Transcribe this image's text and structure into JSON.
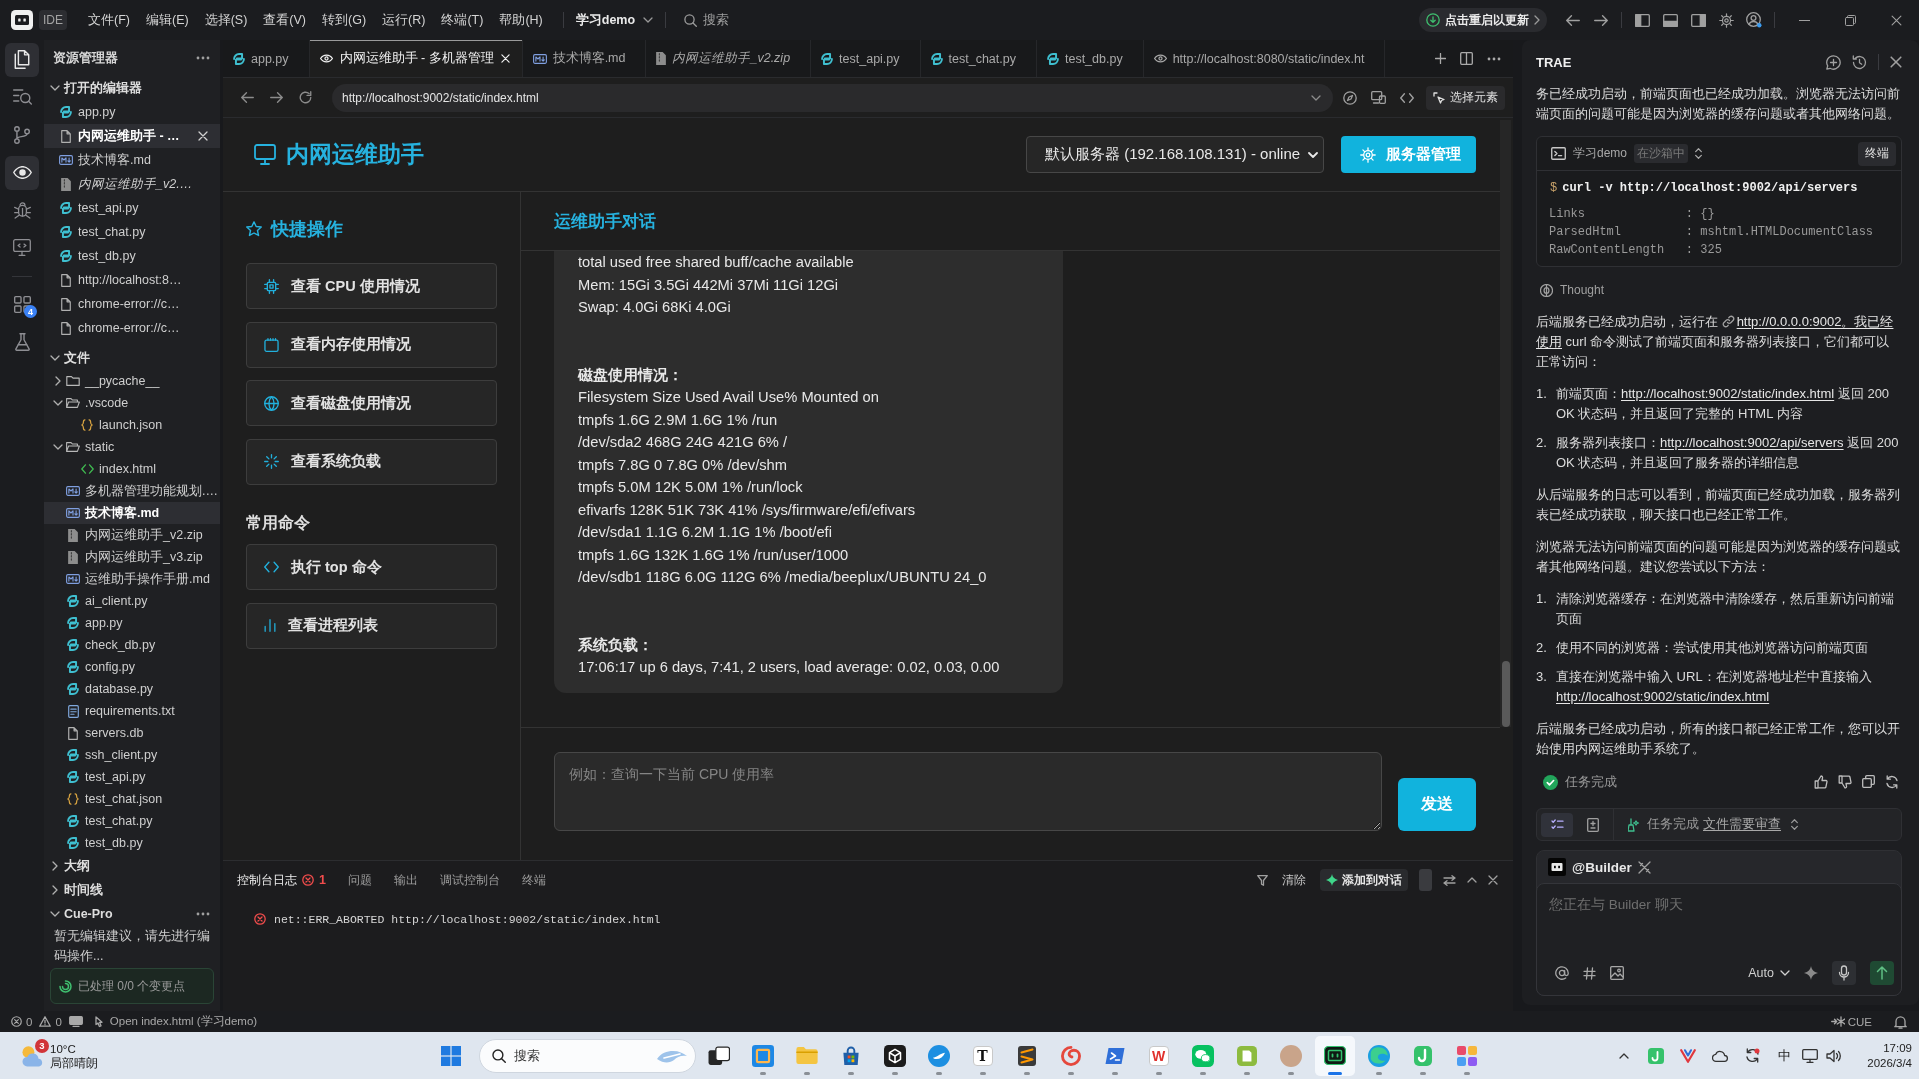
{
  "title_bar": {
    "app_name": "IDE",
    "menus": [
      "文件(F)",
      "编辑(E)",
      "选择(S)",
      "查看(V)",
      "转到(G)",
      "运行(R)",
      "终端(T)",
      "帮助(H)"
    ],
    "project": "学习demo",
    "search_placeholder": "搜索",
    "update_button": "点击重启以更新"
  },
  "activity_bar": {
    "items": [
      {
        "kind": "files",
        "selected": true
      },
      {
        "kind": "search",
        "selected": false
      },
      {
        "kind": "source-control",
        "selected": false
      },
      {
        "kind": "preview",
        "selected": true
      },
      {
        "kind": "debug",
        "selected": false
      },
      {
        "kind": "remote",
        "selected": false
      },
      {
        "kind": "extensions",
        "selected": false,
        "badge": "4"
      },
      {
        "kind": "testing",
        "selected": false
      }
    ]
  },
  "explorer": {
    "title": "资源管理器",
    "open_editors": {
      "title": "打开的编辑器",
      "expanded": true,
      "items": [
        {
          "name": "app.py",
          "kind": "python",
          "selected": false,
          "preview": false
        },
        {
          "name": "内网运维助手 - …",
          "kind": "file",
          "selected": true,
          "preview": false
        },
        {
          "name": "技术博客.md",
          "kind": "markdown",
          "selected": false,
          "preview": false
        },
        {
          "name": "内网运维助手_v2.…",
          "kind": "zip",
          "selected": false,
          "preview": true
        },
        {
          "name": "test_api.py",
          "kind": "python",
          "selected": false,
          "preview": false
        },
        {
          "name": "test_chat.py",
          "kind": "python",
          "selected": false,
          "preview": false
        },
        {
          "name": "test_db.py",
          "kind": "python",
          "selected": false,
          "preview": false
        },
        {
          "name": "http://localhost:8…",
          "kind": "file",
          "selected": false,
          "preview": false
        },
        {
          "name": "chrome-error://c…",
          "kind": "file",
          "selected": false,
          "preview": false
        },
        {
          "name": "chrome-error://c…",
          "kind": "file",
          "selected": false,
          "preview": false
        }
      ]
    },
    "files": {
      "title": "文件",
      "expanded": true,
      "tree": [
        {
          "name": "__pycache__",
          "kind": "folder",
          "expanded": false,
          "selected": false
        },
        {
          "name": ".vscode",
          "kind": "folder",
          "expanded": true,
          "selected": false,
          "children": [
            {
              "name": "launch.json",
              "kind": "json",
              "selected": false
            }
          ]
        },
        {
          "name": "static",
          "kind": "folder",
          "expanded": true,
          "selected": false,
          "children": [
            {
              "name": "index.html",
              "kind": "html",
              "selected": false
            }
          ]
        },
        {
          "name": "多机器管理功能规划.…",
          "kind": "markdown",
          "selected": false
        },
        {
          "name": "技术博客.md",
          "kind": "markdown",
          "selected": true
        },
        {
          "name": "内网运维助手_v2.zip",
          "kind": "zip",
          "selected": false
        },
        {
          "name": "内网运维助手_v3.zip",
          "kind": "zip",
          "selected": false
        },
        {
          "name": "运维助手操作手册.md",
          "kind": "markdown",
          "selected": false
        },
        {
          "name": "ai_client.py",
          "kind": "python",
          "selected": false
        },
        {
          "name": "app.py",
          "kind": "python",
          "selected": false
        },
        {
          "name": "check_db.py",
          "kind": "python",
          "selected": false
        },
        {
          "name": "config.py",
          "kind": "python",
          "selected": false
        },
        {
          "name": "database.py",
          "kind": "python",
          "selected": false
        },
        {
          "name": "requirements.txt",
          "kind": "text",
          "selected": false
        },
        {
          "name": "servers.db",
          "kind": "file",
          "selected": false
        },
        {
          "name": "ssh_client.py",
          "kind": "python",
          "selected": false
        },
        {
          "name": "test_api.py",
          "kind": "python",
          "selected": false
        },
        {
          "name": "test_chat.json",
          "kind": "json",
          "selected": false
        },
        {
          "name": "test_chat.py",
          "kind": "python",
          "selected": false
        },
        {
          "name": "test_db.py",
          "kind": "python",
          "selected": false
        }
      ]
    },
    "outline": {
      "title": "大纲",
      "expanded": false
    },
    "timeline": {
      "title": "时间线",
      "expanded": false
    },
    "cue_pro": {
      "title": "Cue-Pro",
      "expanded": true,
      "message": "暂无编辑建议，请先进行编码操作...",
      "status": "已处理 0/0 个变更点"
    }
  },
  "editor_tabs": [
    {
      "label": "app.py",
      "kind": "python",
      "selected": false,
      "preview": false
    },
    {
      "label": "内网运维助手 - 多机器管理",
      "kind": "browser",
      "selected": true,
      "preview": false
    },
    {
      "label": "技术博客.md",
      "kind": "markdown",
      "selected": false,
      "preview": false
    },
    {
      "label": "内网运维助手_v2.zip",
      "kind": "zip",
      "selected": false,
      "preview": true
    },
    {
      "label": "test_api.py",
      "kind": "python",
      "selected": false,
      "preview": false
    },
    {
      "label": "test_chat.py",
      "kind": "python",
      "selected": false,
      "preview": false
    },
    {
      "label": "test_db.py",
      "kind": "python",
      "selected": false,
      "preview": false
    },
    {
      "label": "http://localhost:8080/static/index.ht",
      "kind": "browser",
      "selected": false,
      "preview": false
    }
  ],
  "browser_bar": {
    "url": "http://localhost:9002/static/index.html",
    "inspect_button": "选择元素"
  },
  "web_page": {
    "title": "内网运维助手",
    "server_select": "默认服务器 (192.168.108.131) - online",
    "manage_button": "服务器管理",
    "sections": [
      {
        "kind": "quick",
        "title": "快捷操作",
        "buttons": [
          {
            "kind": "cpu",
            "label": "查看 CPU 使用情况"
          },
          {
            "kind": "memory",
            "label": "查看内存使用情况"
          },
          {
            "kind": "globe",
            "label": "查看磁盘使用情况"
          },
          {
            "kind": "loader",
            "label": "查看系统负载"
          }
        ]
      },
      {
        "kind": "commands",
        "title": "常用命令",
        "buttons": [
          {
            "kind": "code",
            "label": "执行 top 命令"
          },
          {
            "kind": "chart",
            "label": "查看进程列表"
          }
        ]
      }
    ],
    "chat": {
      "title": "运维助手对话",
      "message_blocks": [
        {
          "lines": [
            "total used free shared buff/cache available",
            "Mem: 15Gi 3.5Gi 442Mi 37Mi 11Gi 12Gi",
            "Swap: 4.0Gi 68Ki 4.0Gi"
          ]
        },
        {
          "heading": "磁盘使用情况：",
          "lines": [
            "Filesystem Size Used Avail Use% Mounted on",
            "tmpfs 1.6G 2.9M 1.6G 1% /run",
            "/dev/sda2 468G 24G 421G 6% /",
            "tmpfs 7.8G 0 7.8G 0% /dev/shm",
            "tmpfs 5.0M 12K 5.0M 1% /run/lock",
            "efivarfs 128K 51K 73K 41% /sys/firmware/efi/efivars",
            "/dev/sda1 1.1G 6.2M 1.1G 1% /boot/efi",
            "tmpfs 1.6G 132K 1.6G 1% /run/user/1000",
            "/dev/sdb1 118G 6.0G 112G 6% /media/beeplux/UBUNTU 24_0"
          ]
        },
        {
          "heading": "系统负载：",
          "lines": [
            "17:06:17 up 6 days, 7:41, 2 users, load average: 0.02, 0.03, 0.00"
          ]
        }
      ],
      "input_placeholder": "例如：查询一下当前 CPU 使用率",
      "send_button": "发送"
    }
  },
  "bottom_panel": {
    "tabs": [
      {
        "label": "控制台日志",
        "selected": true,
        "error_count": "1"
      },
      {
        "label": "问题",
        "selected": false
      },
      {
        "label": "输出",
        "selected": false
      },
      {
        "label": "调试控制台",
        "selected": false
      },
      {
        "label": "终端",
        "selected": false
      }
    ],
    "clear_button": "清除",
    "add_button": "添加到对话",
    "logs": [
      {
        "kind": "error",
        "text": "net::ERR_ABORTED http://localhost:9002/static/index.html"
      }
    ]
  },
  "assistant_panel": {
    "title": "TRAE",
    "blocks": [
      {
        "kind": "paragraph",
        "parts": [
          {
            "kind": "text",
            "text": "务已经成功启动，前端页面也已经成功加载。浏览器无法访问前端页面的问题可能是因为浏览器的缓存问题或者其他网络问题。"
          }
        ]
      },
      {
        "kind": "terminal",
        "workspace": "学习demo",
        "badge": "在沙箱中",
        "button": "终端",
        "prompt": "$",
        "command": "curl -v http://localhost:9002/api/servers",
        "output": [
          "Links              : {}",
          "ParsedHtml         : mshtml.HTMLDocumentClass",
          "RawContentLength   : 325"
        ]
      },
      {
        "kind": "thought",
        "label": "Thought"
      },
      {
        "kind": "paragraph",
        "parts": [
          {
            "kind": "text",
            "text": "后端服务已经成功启动，运行在 "
          },
          {
            "kind": "link",
            "text": "http://0.0.0.0:9002。我已经",
            "icon": true
          },
          {
            "kind": "link",
            "text": "使用"
          },
          {
            "kind": "text",
            "text": " curl 命令测试了前端页面和服务器列表接口，它们都可以正常访问："
          }
        ]
      },
      {
        "kind": "list",
        "items": [
          {
            "marker": "1.",
            "parts": [
              {
                "kind": "text",
                "text": "前端页面："
              },
              {
                "kind": "link",
                "text": "http://localhost:9002/static/index.html"
              },
              {
                "kind": "text",
                "text": " 返回 200 OK 状态码，并且返回了完整的 HTML 内容"
              }
            ]
          },
          {
            "marker": "2.",
            "parts": [
              {
                "kind": "text",
                "text": "服务器列表接口："
              },
              {
                "kind": "link",
                "text": "http://localhost:9002/api/servers"
              },
              {
                "kind": "text",
                "text": " 返回 200 OK 状态码，并且返回了服务器的详细信息"
              }
            ]
          }
        ]
      },
      {
        "kind": "paragraph",
        "parts": [
          {
            "kind": "text",
            "text": "从后端服务的日志可以看到，前端页面已经成功加载，服务器列表已经成功获取，聊天接口也已经正常工作。"
          }
        ]
      },
      {
        "kind": "paragraph",
        "parts": [
          {
            "kind": "text",
            "text": "浏览器无法访问前端页面的问题可能是因为浏览器的缓存问题或者其他网络问题。建议您尝试以下方法："
          }
        ]
      },
      {
        "kind": "list",
        "items": [
          {
            "marker": "1.",
            "parts": [
              {
                "kind": "text",
                "text": "清除浏览器缓存：在浏览器中清除缓存，然后重新访问前端页面"
              }
            ]
          },
          {
            "marker": "2.",
            "parts": [
              {
                "kind": "text",
                "text": "使用不同的浏览器：尝试使用其他浏览器访问前端页面"
              }
            ]
          },
          {
            "marker": "3.",
            "parts": [
              {
                "kind": "text",
                "text": "直接在浏览器中输入 URL：在浏览器地址栏中直接输入 "
              },
              {
                "kind": "link",
                "text": "http://localhost:9002/static/index.html"
              }
            ]
          }
        ]
      },
      {
        "kind": "paragraph",
        "parts": [
          {
            "kind": "text",
            "text": "后端服务已经成功启动，所有的接口都已经正常工作，您可以开始使用内网运维助手系统了。"
          }
        ]
      },
      {
        "kind": "status",
        "label": "任务完成",
        "done": true
      }
    ],
    "review_bar": {
      "views": [
        {
          "kind": "checklist",
          "selected": true
        },
        {
          "kind": "document",
          "selected": false
        }
      ],
      "status": "任务完成",
      "link": "文件需要审查"
    },
    "composer": {
      "agent": "@Builder",
      "placeholder": "您正在与 Builder 聊天",
      "model": "Auto"
    }
  },
  "status_bar": {
    "errors": "0",
    "warnings": "0",
    "message": "Open index.html (学习demo)",
    "cue_label": "CUE"
  },
  "taskbar": {
    "weather": {
      "temperature": "10°C",
      "condition": "局部晴朗",
      "badge": "3"
    },
    "search_placeholder": "搜索",
    "apps": [
      {
        "kind": "task-view",
        "running": false,
        "selected": false
      },
      {
        "kind": "framed-square",
        "running": true,
        "selected": false
      },
      {
        "kind": "folder",
        "running": true,
        "selected": false
      },
      {
        "kind": "store",
        "running": true,
        "selected": false
      },
      {
        "kind": "cube",
        "running": true,
        "selected": false
      },
      {
        "kind": "disc",
        "running": true,
        "selected": false
      },
      {
        "kind": "letter",
        "label": "T",
        "running": true,
        "selected": false
      },
      {
        "kind": "stripes",
        "running": true,
        "selected": false
      },
      {
        "kind": "swirl",
        "running": true,
        "selected": false
      },
      {
        "kind": "prompt",
        "running": true,
        "selected": false
      },
      {
        "kind": "letter-accent",
        "label": "W",
        "running": true,
        "selected": false
      },
      {
        "kind": "chat",
        "running": true,
        "selected": false
      },
      {
        "kind": "tile",
        "running": true,
        "selected": false
      },
      {
        "kind": "avatar",
        "running": true,
        "selected": false
      },
      {
        "kind": "screen",
        "running": true,
        "selected": true
      },
      {
        "kind": "swirl-disc",
        "running": true,
        "selected": false
      },
      {
        "kind": "hook",
        "running": true,
        "selected": false
      },
      {
        "kind": "grid",
        "running": true,
        "selected": false
      }
    ],
    "tray": {
      "ime": "中",
      "time": "17:09",
      "date": "2026/3/4"
    }
  }
}
